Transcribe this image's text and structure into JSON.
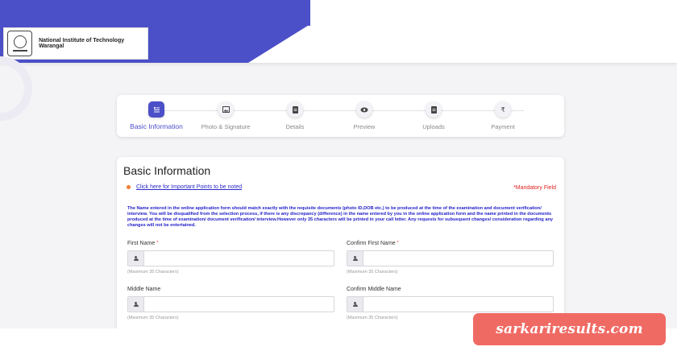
{
  "header": {
    "institute_name": "National Institute of Technology Warangal",
    "band_color": "#4b4fc8"
  },
  "stepper": {
    "steps": [
      {
        "label": "Basic Information",
        "icon": "form-icon",
        "active": true
      },
      {
        "label": "Photo & Signature",
        "icon": "image-icon",
        "active": false
      },
      {
        "label": "Details",
        "icon": "document-icon",
        "active": false
      },
      {
        "label": "Preview",
        "icon": "eye-icon",
        "active": false
      },
      {
        "label": "Uploads",
        "icon": "file-icon",
        "active": false
      },
      {
        "label": "Payment",
        "icon": "rupee-icon",
        "active": false
      }
    ]
  },
  "form": {
    "title": "Basic Information",
    "important_points_link": "Click here for Important Points to be noted",
    "mandatory_label": "*Mandatory Field",
    "notice": "The Name entered in the online application form should match exactly with the requisite documents (photo ID,DOB etc.) to be produced at the time of the examination and document verification/ interview. You will be disqualified from the selection process, if there is any discrepancy (difference) in the name entered by you in the online application form and the name printed in the documents produced at the time of examination/ document verification/ interview.However only 35 characters will be printed in your call letter. Any requests for subsequent changes/ consideration regarding any changes will not be entertained.",
    "fields": {
      "first_name": {
        "label": "First Name",
        "required_mark": "*",
        "value": "",
        "hint": "(Maximum 35 Characters)"
      },
      "confirm_first_name": {
        "label": "Confirm First Name",
        "required_mark": "*",
        "value": "",
        "hint": "(Maximum 35 Characters)"
      },
      "middle_name": {
        "label": "Middle Name",
        "value": "",
        "hint": "(Maximum 35 Characters)"
      },
      "confirm_middle_name": {
        "label": "Confirm Middle Name",
        "value": "",
        "hint": "(Maximum 35 Characters)"
      }
    }
  },
  "watermark": {
    "text": "sarkariresults.com",
    "color": "#f06a64"
  }
}
